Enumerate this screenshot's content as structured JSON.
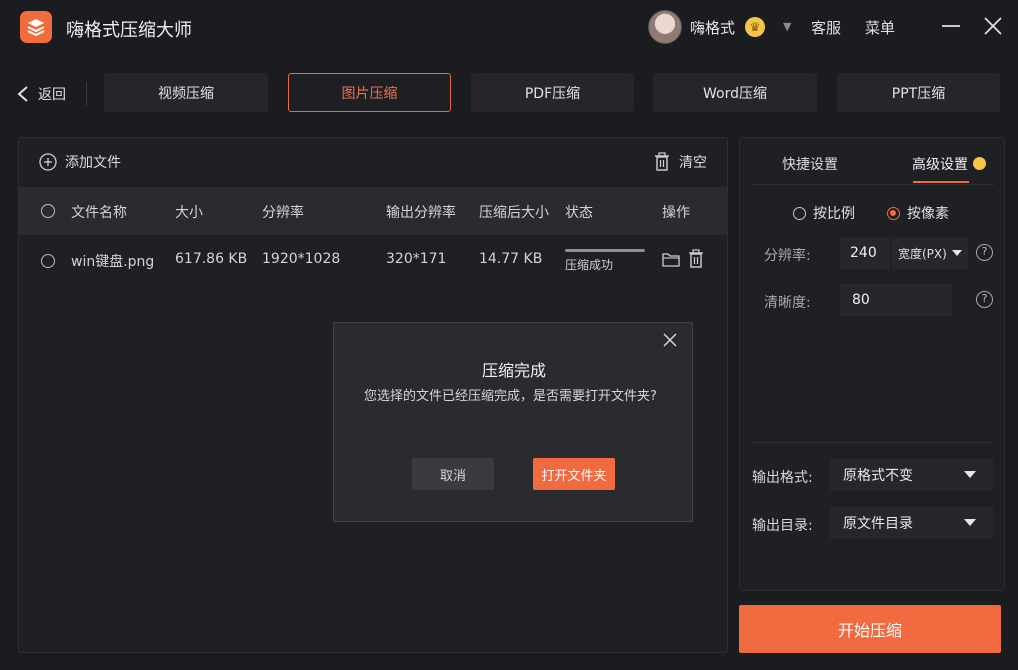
{
  "app": {
    "title": "嗨格式压缩大师",
    "username": "嗨格式",
    "service": "客服",
    "menu": "菜单",
    "accent": "#f26a3f"
  },
  "nav": {
    "back_label": "返回",
    "tabs": [
      {
        "label": "视频压缩",
        "active": false
      },
      {
        "label": "图片压缩",
        "active": true
      },
      {
        "label": "PDF压缩",
        "active": false
      },
      {
        "label": "Word压缩",
        "active": false
      },
      {
        "label": "PPT压缩",
        "active": false
      }
    ]
  },
  "files": {
    "add_label": "添加文件",
    "clear_label": "清空",
    "columns": [
      "文件名称",
      "大小",
      "分辨率",
      "输出分辨率",
      "压缩后大小",
      "状态",
      "操作"
    ],
    "rows": [
      {
        "name": "win键盘.png",
        "size": "617.86 KB",
        "resolution": "1920*1028",
        "output_resolution": "320*171",
        "compressed_size": "14.77 KB",
        "status": "压缩成功",
        "progress": 1.0
      }
    ]
  },
  "dialog": {
    "title": "压缩完成",
    "message": "您选择的文件已经压缩完成，是否需要打开文件夹?",
    "cancel_label": "取消",
    "open_label": "打开文件夹"
  },
  "settings": {
    "tab_quick": "快捷设置",
    "tab_advanced": "高级设置",
    "mode_ratio": "按比例",
    "mode_pixel": "按像素",
    "resolution_label": "分辨率:",
    "resolution_value": "240",
    "resolution_unit": "宽度(PX)",
    "clarity_label": "清晰度:",
    "clarity_value": "80",
    "help_glyph": "?",
    "output_format_label": "输出格式:",
    "output_format_value": "原格式不变",
    "output_dir_label": "输出目录:",
    "output_dir_value": "原文件目录"
  },
  "actions": {
    "start_label": "开始压缩"
  }
}
